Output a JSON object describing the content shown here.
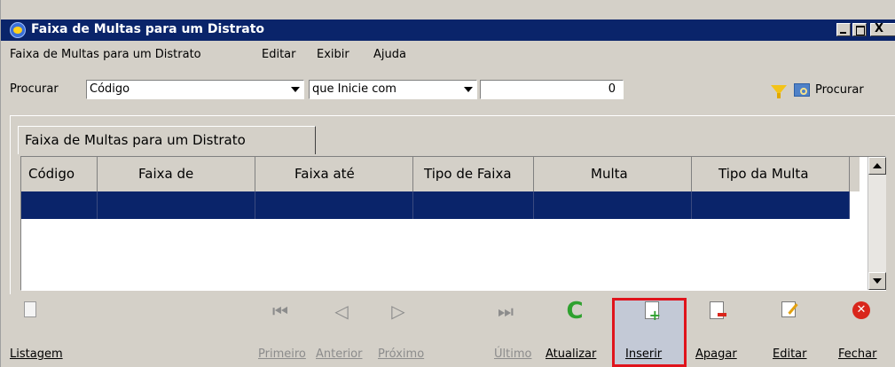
{
  "window": {
    "title": "Faixa de Multas para um Distrato",
    "controls": {
      "minimize": "_",
      "maximize": "□",
      "close": "X"
    }
  },
  "menu": {
    "items": [
      "Faixa de Multas para um Distrato",
      "Editar",
      "Exibir",
      "Ajuda"
    ]
  },
  "search": {
    "label": "Procurar",
    "field_select": "Código",
    "mode_select": "que Inicie com",
    "value": "0",
    "button_label": "Procurar"
  },
  "tab": {
    "label": "Faixa de Multas para um Distrato"
  },
  "grid": {
    "columns": [
      "Código",
      "Faixa de",
      "Faixa até",
      "Tipo de Faixa",
      "Multa",
      "Tipo da Multa"
    ],
    "selected_row_color": "#0a246a"
  },
  "toolbar": {
    "listagem": "Listagem",
    "primeiro": "Primeiro",
    "anterior": "Anterior",
    "proximo": "Próximo",
    "ultimo": "Último",
    "atualizar": "Atualizar",
    "inserir": "Inserir",
    "apagar": "Apagar",
    "editar": "Editar",
    "fechar": "Fechar"
  },
  "colors": {
    "titlebar": "#0a246a",
    "highlight_border": "#e0141c",
    "chrome": "#d4d0c8"
  }
}
